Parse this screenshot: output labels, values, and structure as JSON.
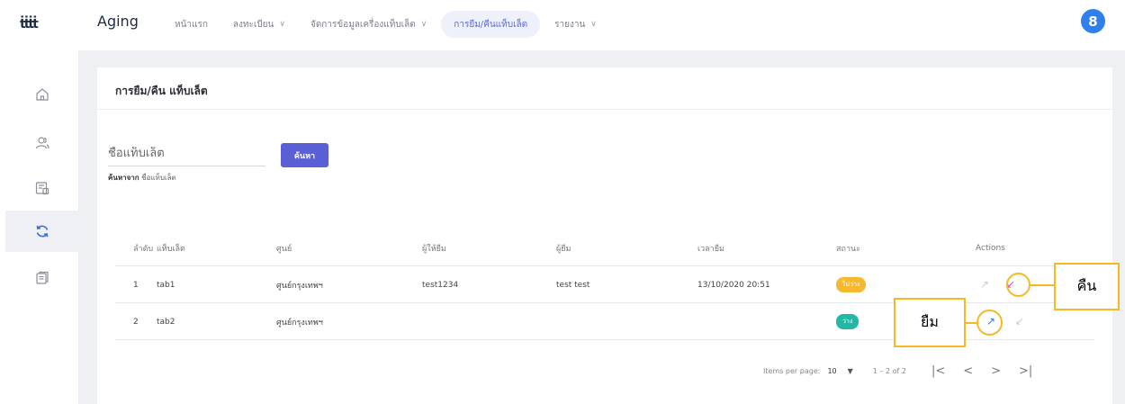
{
  "app": {
    "logo": "ṫṫṫṫ",
    "name": "Aging"
  },
  "nav": [
    {
      "label": "หน้าแรก",
      "chevron": false,
      "active": false
    },
    {
      "label": "ลงทะเบียน",
      "chevron": true,
      "active": false
    },
    {
      "label": "จัดการข้อมูลเครื่องแท็บเล็ต",
      "chevron": true,
      "active": false
    },
    {
      "label": "การยืม/คืนแท็บเล็ต",
      "chevron": false,
      "active": true
    },
    {
      "label": "รายงาน",
      "chevron": true,
      "active": false
    }
  ],
  "user": {
    "avatar_letter": "8"
  },
  "sidebar": [
    {
      "icon": "home-icon",
      "active": false
    },
    {
      "icon": "users-icon",
      "active": false
    },
    {
      "icon": "devices-icon",
      "active": false
    },
    {
      "icon": "refresh-icon",
      "active": true
    },
    {
      "icon": "documents-icon",
      "active": false
    }
  ],
  "page": {
    "title": "การยืม/คืน แท็บเล็ต"
  },
  "search": {
    "placeholder": "ชื่อแท็บเล็ต",
    "hint_prefix": "ค้นหาจาก",
    "hint_field": "ชื่อแท็บเล็ต",
    "button": "ค้นหา"
  },
  "table": {
    "headers": {
      "no": "ลำดับ",
      "tablet": "แท็บเล็ต",
      "center": "ศูนย์",
      "lender": "ผู้ให้ยืม",
      "borrower": "ผู้ยืม",
      "time": "เวลายืม",
      "status": "สถานะ",
      "actions": "Actions"
    },
    "rows": [
      {
        "no": "1",
        "tablet": "tab1",
        "center": "ศูนย์กรุงเทพฯ",
        "lender": "test1234",
        "borrower": "test test",
        "time": "13/10/2020 20:51",
        "status": "ไม่ว่าง",
        "status_color": "#f5b82e"
      },
      {
        "no": "2",
        "tablet": "tab2",
        "center": "ศูนย์กรุงเทพฯ",
        "lender": "",
        "borrower": "",
        "time": "",
        "status": "ว่าง",
        "status_color": "#21b8a5"
      }
    ]
  },
  "paginator": {
    "items_per_page_label": "Items per page:",
    "page_size": "10",
    "range": "1 – 2 of 2"
  },
  "annotations": {
    "return_label": "คืน",
    "borrow_label": "ยืม",
    "highlight_color": "#f6b921"
  },
  "icons": {
    "borrow": "↗",
    "return": "↙",
    "chevron_down": "∨",
    "dropdown": "▼",
    "first_page": "|<",
    "prev_page": "<",
    "next_page": ">",
    "last_page": ">|"
  }
}
